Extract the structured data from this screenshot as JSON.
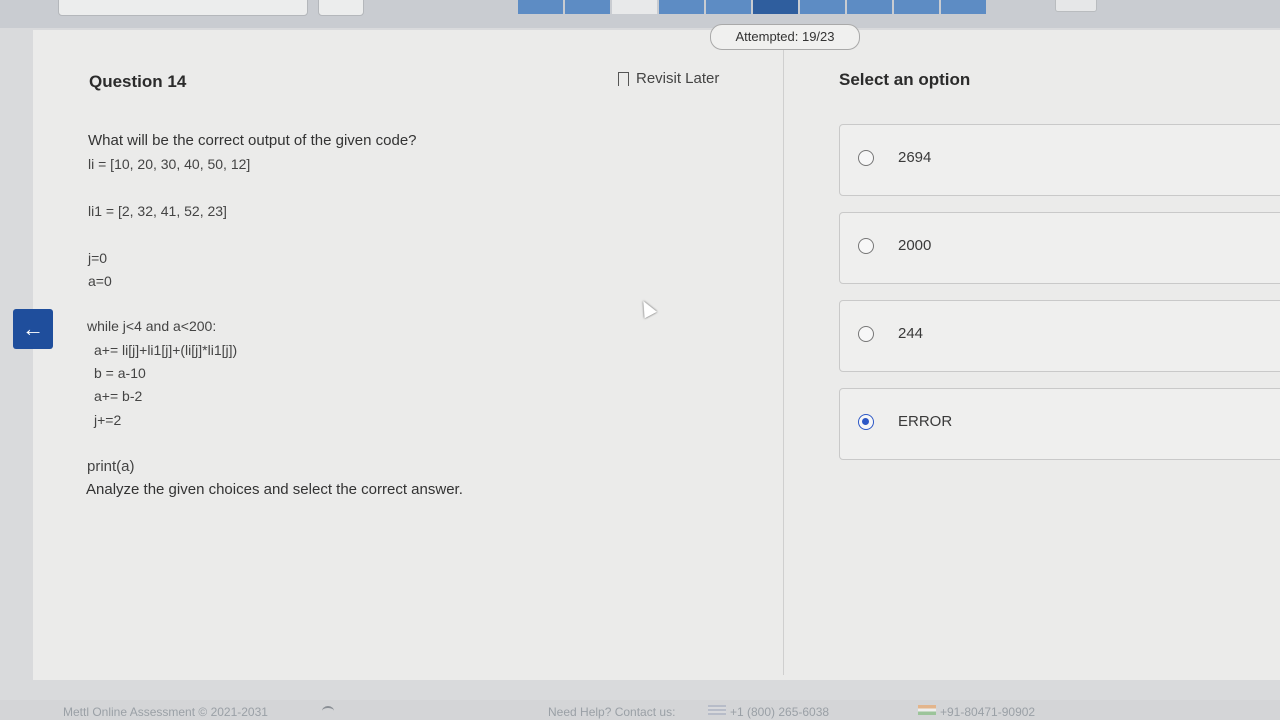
{
  "top": {
    "attempted": "Attempted: 19/23"
  },
  "question": {
    "title": "Question 14",
    "revisit_label": "Revisit Later",
    "prompt": "What will be the correct output of the given code?",
    "code": [
      "li = [10, 20, 30, 40, 50, 12]",
      "li1 = [2, 32, 41, 52, 23]",
      "j=0",
      "a=0",
      "while j<4 and a<200:",
      "a+= li[j]+li1[j]+(li[j]*li1[j])",
      "b = a-10",
      "a+= b-2",
      "j+=2",
      "print(a)"
    ],
    "instruction": "Analyze the given choices and select the correct answer."
  },
  "options": {
    "title": "Select an option",
    "items": [
      {
        "label": "2694",
        "selected": false
      },
      {
        "label": "2000",
        "selected": false
      },
      {
        "label": "244",
        "selected": false
      },
      {
        "label": "ERROR",
        "selected": true
      }
    ]
  },
  "footer": {
    "copyright": "Mettl Online Assessment © 2021-2031",
    "help": "Need Help? Contact us:",
    "phone_us": "+1 (800) 265-6038",
    "phone_in": "+91-80471-90902"
  },
  "icons": {
    "back": "arrow-left-icon",
    "revisit": "bookmark-icon"
  },
  "colors": {
    "accent": "#2d58c6",
    "back_button": "#1f4e9c"
  }
}
